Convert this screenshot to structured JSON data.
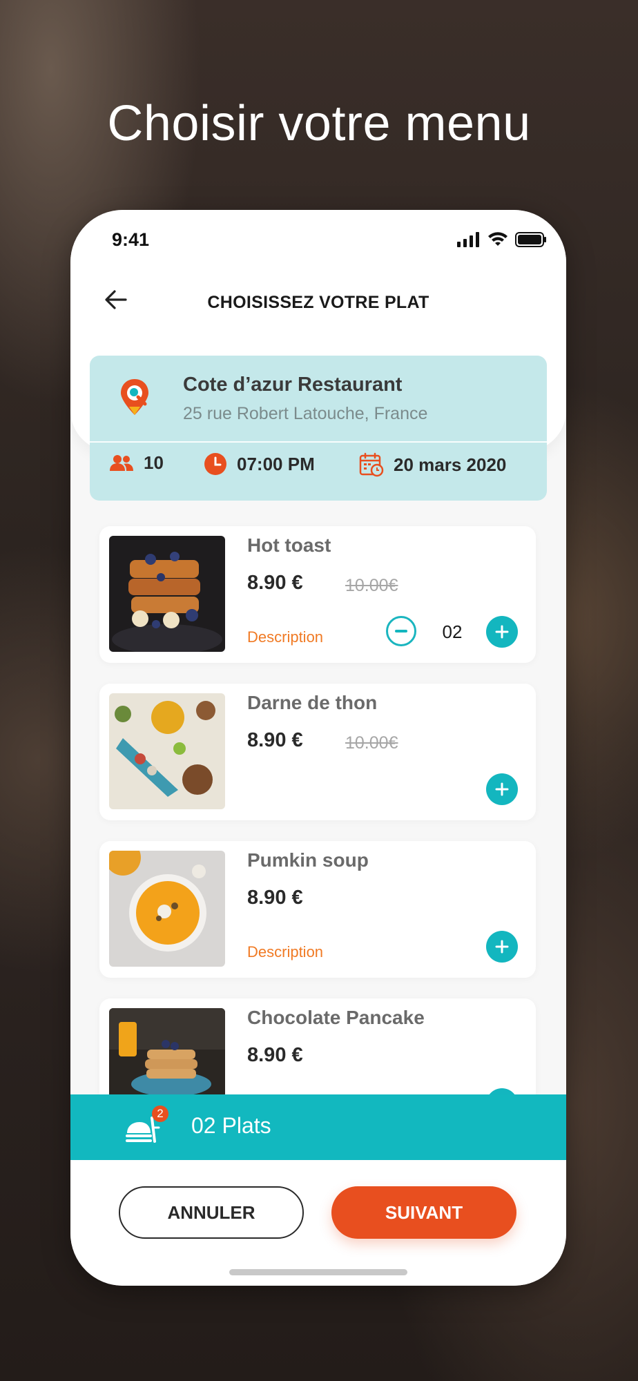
{
  "headline": "Choisir votre menu",
  "status": {
    "time": "9:41"
  },
  "header": {
    "title": "CHOISISSEZ VOTRE PLAT"
  },
  "restaurant": {
    "name": "Cote d’azur Restaurant",
    "address": "25 rue Robert Latouche, France",
    "guests": "10",
    "time": "07:00 PM",
    "date": "20 mars 2020"
  },
  "dishes": [
    {
      "name": "Hot toast",
      "price": "8.90 €",
      "old_price": "10.00€",
      "description": "Description",
      "quantity": "02"
    },
    {
      "name": "Darne de thon",
      "price": "8.90 €",
      "old_price": "10.00€"
    },
    {
      "name": "Pumkin soup",
      "price": "8.90 €",
      "description": "Description"
    },
    {
      "name": "Chocolate Pancake",
      "price": "8.90 €"
    }
  ],
  "cart": {
    "badge": "2",
    "label": "02 Plats"
  },
  "actions": {
    "cancel": "ANNULER",
    "next": "SUIVANT"
  },
  "colors": {
    "teal": "#13b6bf",
    "orange": "#e84f1f",
    "card_bg": "#c4e8ea",
    "description": "#f07a24"
  }
}
